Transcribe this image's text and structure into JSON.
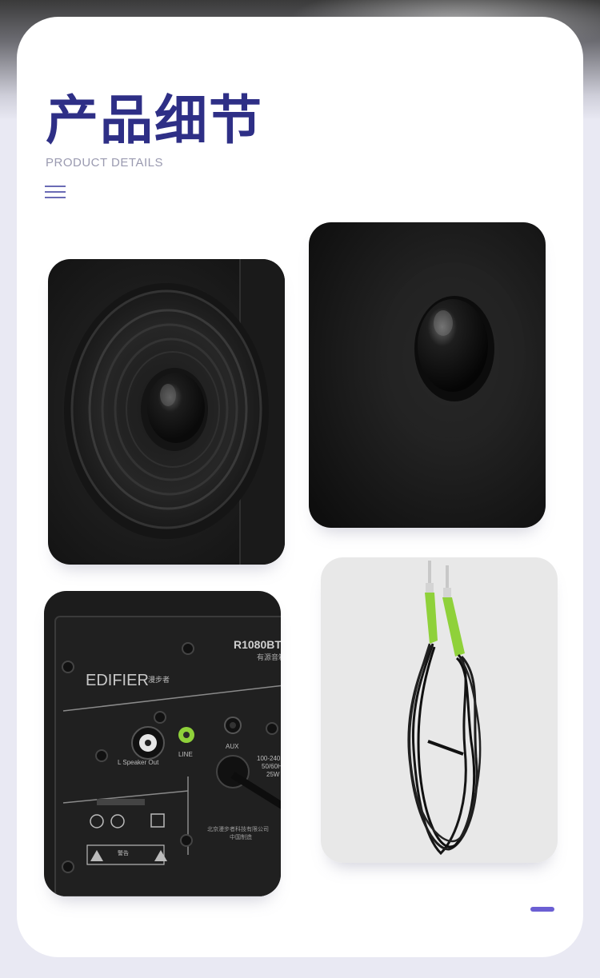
{
  "header": {
    "title": "产品细节",
    "subtitle": "PRODUCT DETAILS"
  },
  "photos": {
    "panel": {
      "brand": "EDIFIER",
      "brand_cn": "漫步者",
      "model": "R1080BT",
      "model_cn": "有源音箱",
      "speaker_out": "L Speaker Out",
      "line": "LINE",
      "aux": "AUX",
      "power_spec": [
        "100-240",
        "50/60H",
        "25W"
      ],
      "maker": "北京漫步者科技有限公司",
      "made_in": "中国制造",
      "warning": "警告"
    }
  },
  "colors": {
    "accent": "#2e2f86",
    "subtitle": "#9a9ab0",
    "menu": "#6a6bb5",
    "dot": "#6b5fd3",
    "cable_plug": "#8fd13a"
  }
}
